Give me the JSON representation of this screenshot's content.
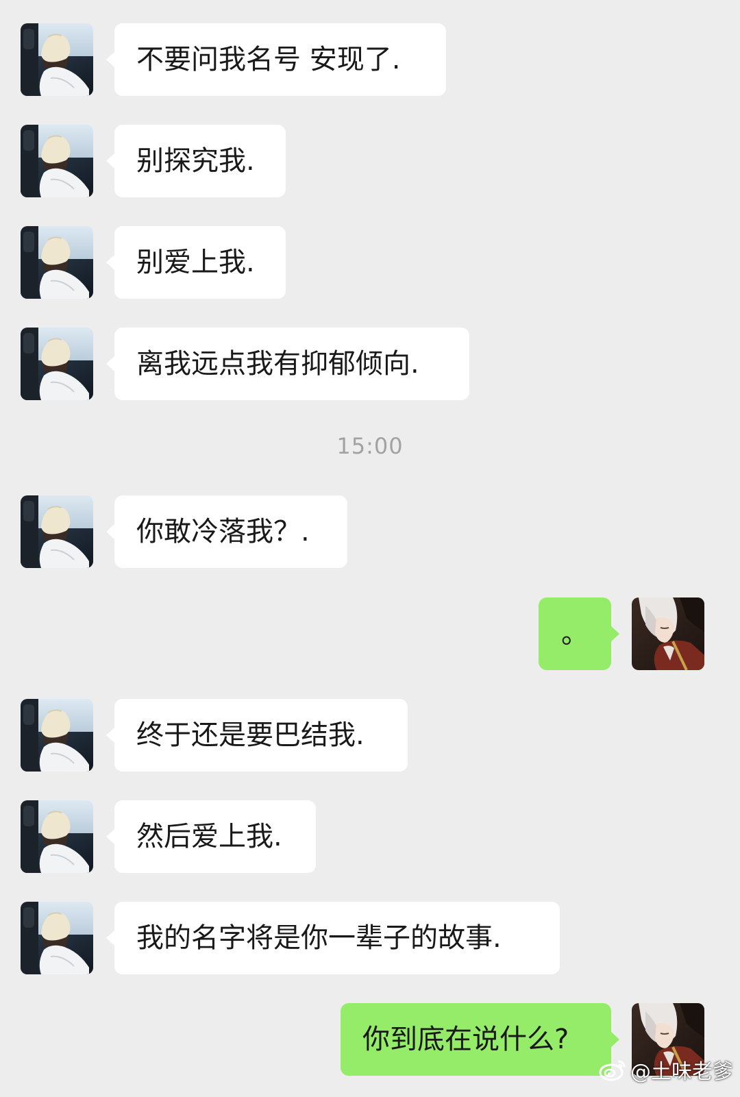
{
  "colors": {
    "background": "#ededed",
    "incoming_bubble": "#ffffff",
    "outgoing_bubble": "#95ec69",
    "timestamp_text": "#a2a2a2"
  },
  "messages": [
    {
      "side": "in",
      "text": "不要问我名号 安现了."
    },
    {
      "side": "in",
      "text": "别探究我."
    },
    {
      "side": "in",
      "text": "别爱上我."
    },
    {
      "side": "in",
      "text": "离我远点我有抑郁倾向."
    },
    {
      "side": "in",
      "text": "你敢冷落我？."
    },
    {
      "side": "out",
      "text": "。"
    },
    {
      "side": "in",
      "text": "终于还是要巴结我."
    },
    {
      "side": "in",
      "text": "然后爱上我."
    },
    {
      "side": "in",
      "text": "我的名字将是你一辈子的故事."
    },
    {
      "side": "out",
      "text": "你到底在说什么?"
    }
  ],
  "timestamp": "15:00",
  "watermark": {
    "text": "@土味老爹",
    "icon": "weibo-icon"
  },
  "avatars": {
    "contact": "contact-avatar-hat-girl",
    "self": "self-avatar-anime-character"
  }
}
